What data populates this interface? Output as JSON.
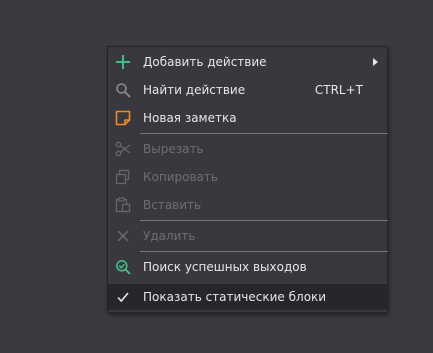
{
  "menu": {
    "items": [
      {
        "label": "Добавить действие",
        "icon": "plus-icon",
        "enabled": true,
        "has_submenu": true
      },
      {
        "label": "Найти действие",
        "icon": "search-icon",
        "enabled": true,
        "shortcut": "CTRL+T"
      },
      {
        "label": "Новая заметка",
        "icon": "note-icon",
        "enabled": true
      },
      {
        "label": "Вырезать",
        "icon": "scissors-icon",
        "enabled": false
      },
      {
        "label": "Копировать",
        "icon": "copy-icon",
        "enabled": false
      },
      {
        "label": "Вставить",
        "icon": "paste-icon",
        "enabled": false
      },
      {
        "label": "Удалить",
        "icon": "delete-icon",
        "enabled": false
      },
      {
        "label": "Поиск успешных выходов",
        "icon": "search-success-icon",
        "enabled": true
      },
      {
        "label": "Показать статические блоки",
        "icon": "checkmark-icon",
        "enabled": true,
        "checked": true
      }
    ]
  },
  "colors": {
    "background": "#3b3a41",
    "menu_bg": "#39383e",
    "selected_bg": "#27262b",
    "accent_green": "#3dbf8a",
    "accent_orange": "#f08c28",
    "text": "#e6e6e6",
    "text_disabled": "#6e6d73"
  }
}
